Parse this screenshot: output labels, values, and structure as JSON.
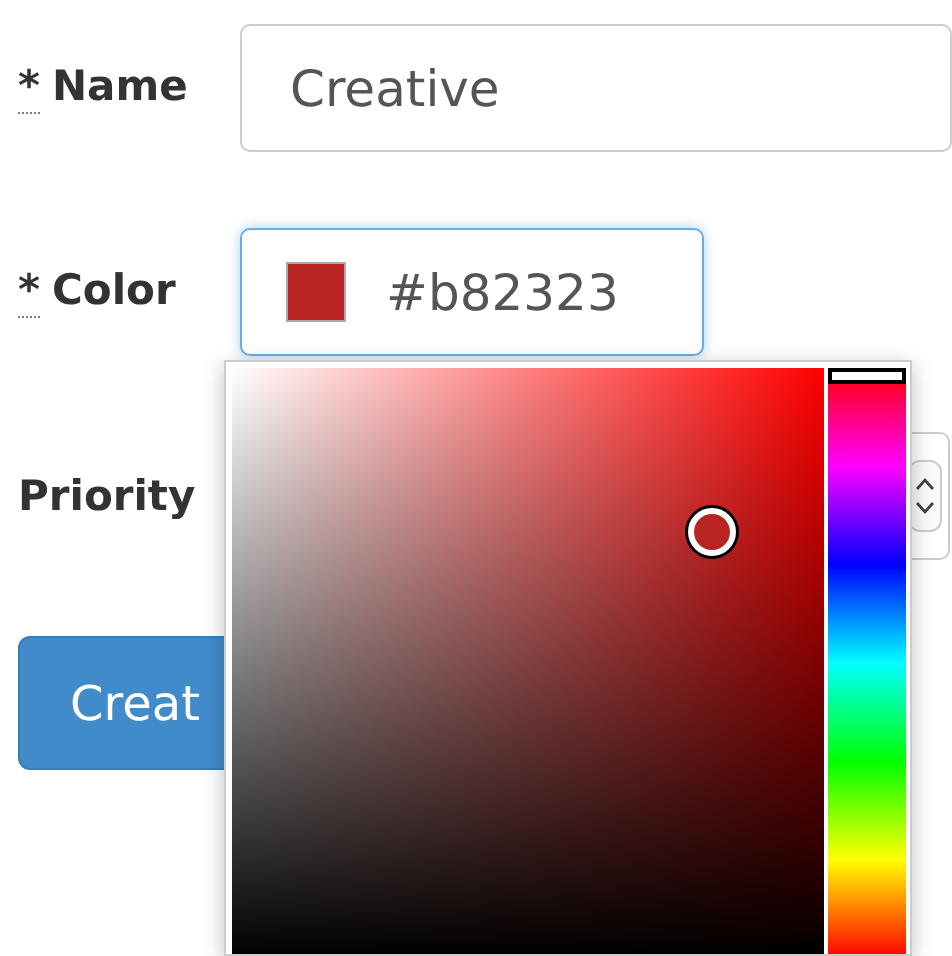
{
  "fields": [
    {
      "kind": "text",
      "marker": "*",
      "label": "Name",
      "value": "Creative",
      "focused": false
    },
    {
      "kind": "color",
      "marker": "*",
      "label": "Color",
      "value": "#b82323",
      "focused": true
    },
    {
      "kind": "number",
      "label": "Priority",
      "focused": false
    }
  ],
  "color_picker": {
    "open": true,
    "hue_slider": {
      "level": 1
    }
  },
  "buttons": [
    {
      "kind": "primary",
      "label": "Creat"
    }
  ]
}
